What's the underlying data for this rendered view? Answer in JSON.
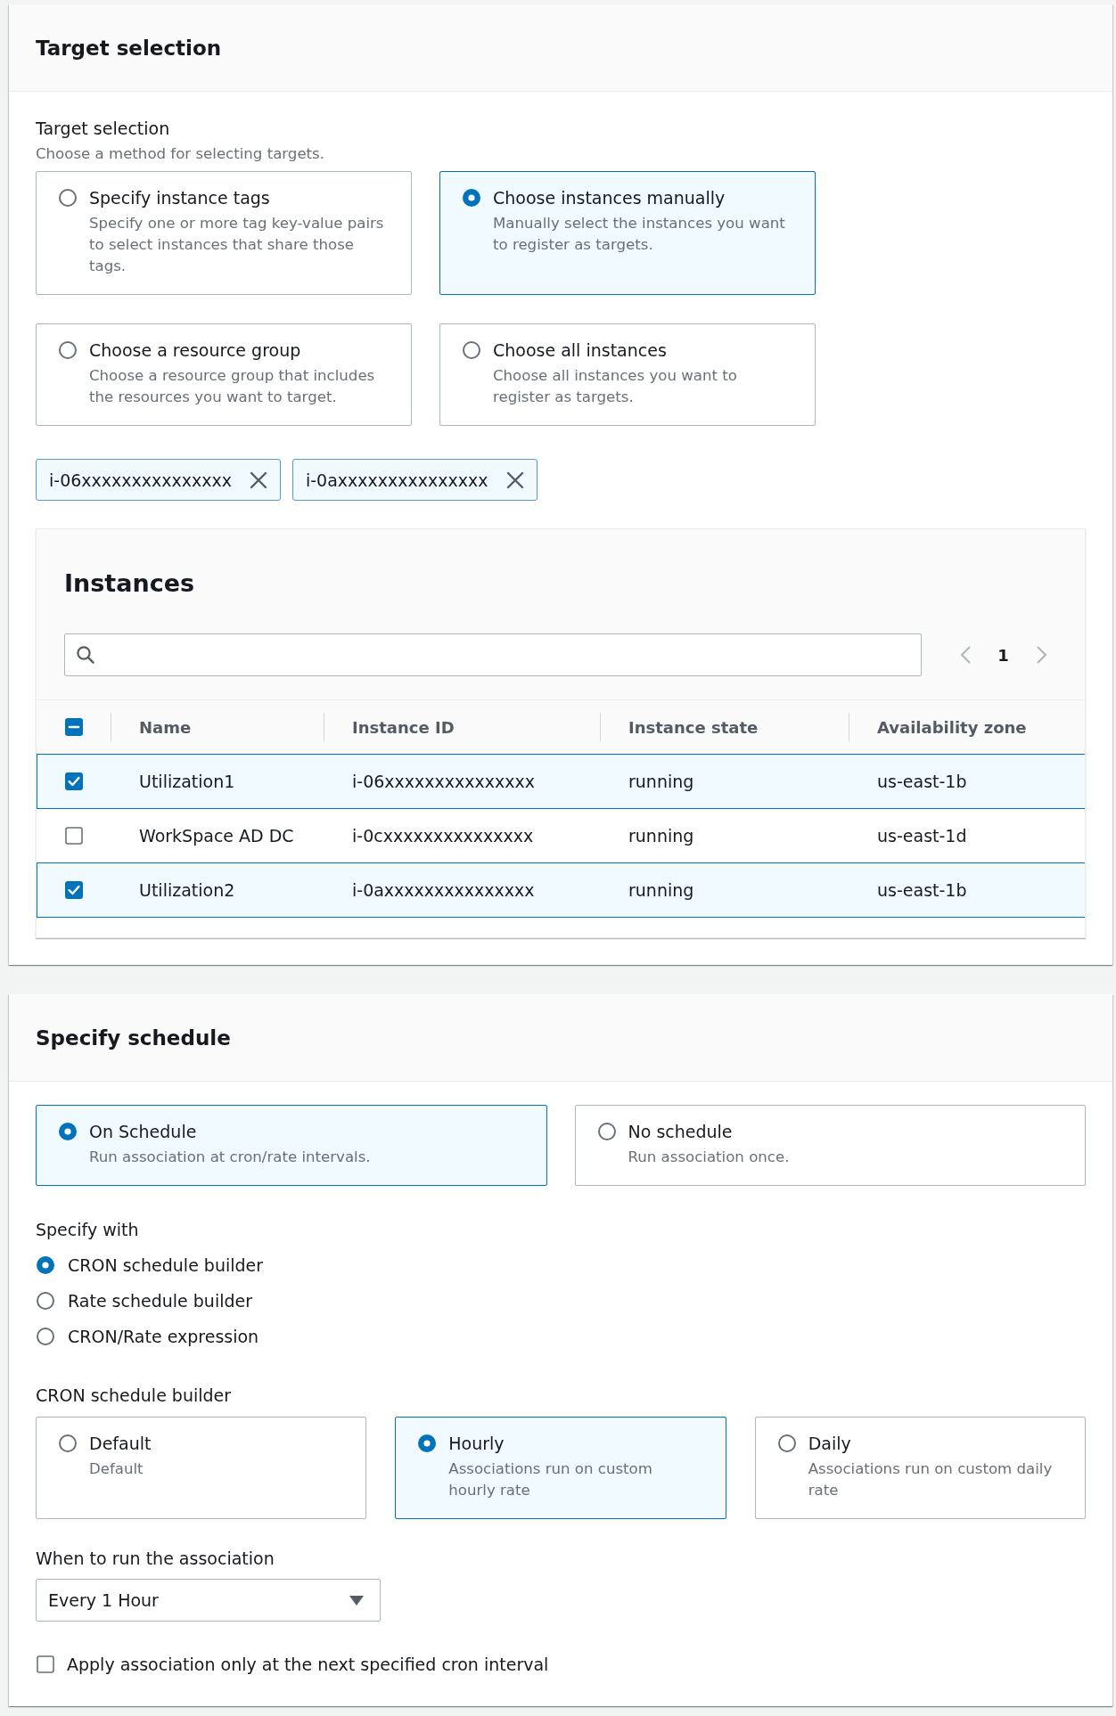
{
  "target_selection": {
    "title": "Target selection",
    "field_label": "Target selection",
    "field_description": "Choose a method for selecting targets.",
    "options": [
      {
        "label": "Specify instance tags",
        "description": "Specify one or more tag key-value pairs to select instances that share those tags.",
        "selected": false
      },
      {
        "label": "Choose instances manually",
        "description": "Manually select the instances you want to register as targets.",
        "selected": true
      },
      {
        "label": "Choose a resource group",
        "description": "Choose a resource group that includes the resources you want to target.",
        "selected": false
      },
      {
        "label": "Choose all instances",
        "description": "Choose all instances you want to register as targets.",
        "selected": false
      }
    ],
    "tokens": [
      {
        "label": "i-06xxxxxxxxxxxxxxx"
      },
      {
        "label": "i-0axxxxxxxxxxxxxxx"
      }
    ],
    "instances": {
      "title": "Instances",
      "pagination": {
        "page": "1",
        "previous_disabled": true,
        "next_disabled": true
      },
      "select_all": {
        "indeterminate": true
      },
      "columns": [
        "Name",
        "Instance ID",
        "Instance state",
        "Availability zone"
      ],
      "rows": [
        {
          "selected": true,
          "cells": [
            "Utilization1",
            "i-06xxxxxxxxxxxxxxx",
            "running",
            "us-east-1b"
          ]
        },
        {
          "selected": false,
          "cells": [
            "WorkSpace AD DC",
            "i-0cxxxxxxxxxxxxxxx",
            "running",
            "us-east-1d"
          ]
        },
        {
          "selected": true,
          "cells": [
            "Utilization2",
            "i-0axxxxxxxxxxxxxxx",
            "running",
            "us-east-1b"
          ]
        }
      ]
    }
  },
  "schedule": {
    "title": "Specify schedule",
    "options": [
      {
        "label": "On Schedule",
        "description": "Run association at cron/rate intervals.",
        "selected": true
      },
      {
        "label": "No schedule",
        "description": "Run association once.",
        "selected": false
      }
    ],
    "specify_with": {
      "label": "Specify with",
      "options": [
        {
          "label": "CRON schedule builder",
          "selected": true
        },
        {
          "label": "Rate schedule builder",
          "selected": false
        },
        {
          "label": "CRON/Rate expression",
          "selected": false
        }
      ]
    },
    "cron_builder": {
      "label": "CRON schedule builder",
      "options": [
        {
          "label": "Default",
          "description": "Default",
          "selected": false
        },
        {
          "label": "Hourly",
          "description": "Associations run on custom hourly rate",
          "selected": true
        },
        {
          "label": "Daily",
          "description": "Associations run on custom daily rate",
          "selected": false
        }
      ]
    },
    "when_to_run": {
      "label": "When to run the association",
      "value": "Every 1 Hour"
    },
    "apply_next_interval": {
      "label": "Apply association only at the next specified cron interval",
      "checked": false
    }
  }
}
